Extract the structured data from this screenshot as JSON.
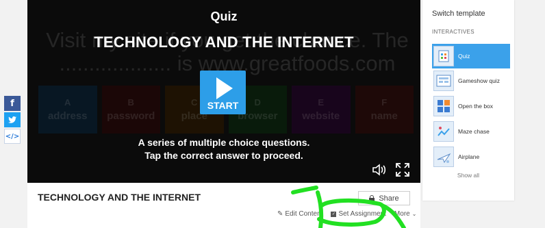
{
  "social": {
    "facebook_glyph": "f",
    "twitter_glyph": "t",
    "embed_glyph": "</>"
  },
  "player": {
    "quiz_label": "Quiz",
    "title": "TECHNOLOGY AND THE INTERNET",
    "bg_sentence_line1": "Visit my site if you get the chance. The",
    "bg_sentence_line2": "................... is www.greatfoods.com",
    "tiles": [
      {
        "key": "A",
        "word": "address"
      },
      {
        "key": "B",
        "word": "password"
      },
      {
        "key": "C",
        "word": "place"
      },
      {
        "key": "D",
        "word": "browser"
      },
      {
        "key": "E",
        "word": "website"
      },
      {
        "key": "F",
        "word": "name"
      }
    ],
    "start_label": "START",
    "description_line1": "A series of multiple choice questions.",
    "description_line2": "Tap the correct answer to proceed."
  },
  "activity": {
    "title": "TECHNOLOGY AND THE INTERNET",
    "share_label": "Share",
    "edit_label": "Edit Content",
    "assign_label": "Set Assignment",
    "more_label": "More"
  },
  "panel": {
    "header": "Switch template",
    "section": "INTERACTIVES",
    "templates": [
      {
        "name": "Quiz",
        "icon": "quiz-icon"
      },
      {
        "name": "Gameshow quiz",
        "icon": "gameshow-icon"
      },
      {
        "name": "Open the box",
        "icon": "open-box-icon"
      },
      {
        "name": "Maze chase",
        "icon": "maze-icon"
      },
      {
        "name": "Airplane",
        "icon": "airplane-icon"
      }
    ],
    "show_all": "Show all"
  },
  "colors": {
    "accent": "#3ba1ea",
    "start": "#2d9ee8",
    "annotation": "#22e022"
  }
}
